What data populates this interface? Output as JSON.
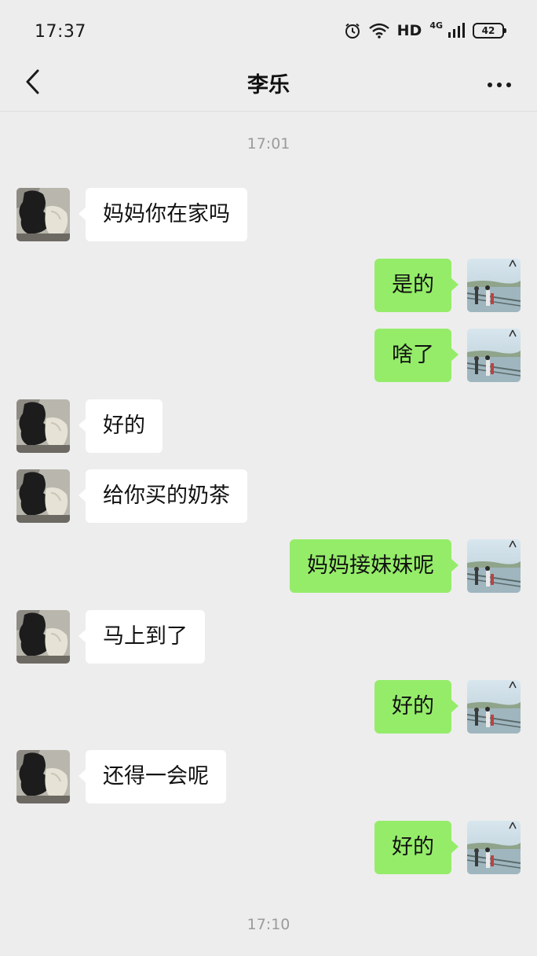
{
  "status_bar": {
    "time": "17:37",
    "hd_label": "HD",
    "network_label": "4G",
    "battery_level": "42"
  },
  "header": {
    "title": "李乐",
    "back_icon": "chevron-left-icon",
    "more_icon": "more-dots-icon"
  },
  "chat": {
    "timestamp_top": "17:01",
    "timestamp_bottom": "17:10",
    "messages": [
      {
        "sender": "contact",
        "text": "妈妈你在家吗"
      },
      {
        "sender": "me",
        "text": "是的"
      },
      {
        "sender": "me",
        "text": "啥了"
      },
      {
        "sender": "contact",
        "text": "好的"
      },
      {
        "sender": "contact",
        "text": "给你买的奶茶"
      },
      {
        "sender": "me",
        "text": "妈妈接妹妹呢"
      },
      {
        "sender": "contact",
        "text": "马上到了"
      },
      {
        "sender": "me",
        "text": "好的"
      },
      {
        "sender": "contact",
        "text": "还得一会呢"
      },
      {
        "sender": "me",
        "text": "好的"
      }
    ]
  },
  "colors": {
    "background": "#ededed",
    "outgoing_bubble": "#95ec69",
    "incoming_bubble": "#ffffff",
    "timestamp_text": "#9b9b9b"
  }
}
